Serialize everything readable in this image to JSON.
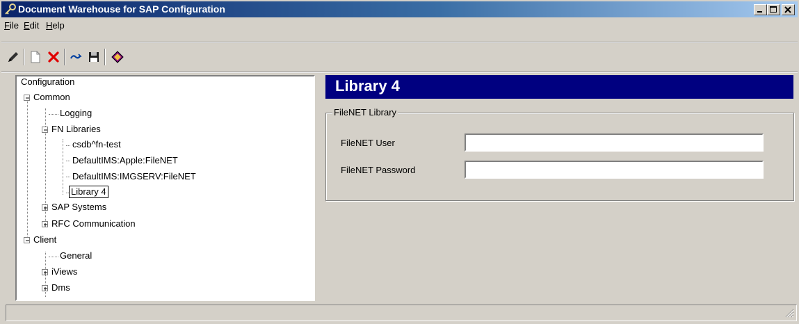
{
  "window": {
    "title": "Document Warehouse for SAP Configuration"
  },
  "menu": [
    {
      "pre": "",
      "ul": "F",
      "post": "ile"
    },
    {
      "pre": "",
      "ul": "E",
      "post": "dit"
    },
    {
      "pre": "",
      "ul": "H",
      "post": "elp"
    }
  ],
  "toolbar": {
    "icons": [
      "pencil-icon",
      "new-document-icon",
      "delete-icon",
      "refresh-icon",
      "save-icon",
      "help-book-icon"
    ]
  },
  "tree": {
    "root": "Configuration",
    "common": "Common",
    "logging": "Logging",
    "fn_libraries": "FN Libraries",
    "lib1": "csdb^fn-test",
    "lib2": "DefaultIMS:Apple:FileNET",
    "lib3": "DefaultIMS:IMGSERV:FileNET",
    "lib4": "Library 4",
    "sap_systems": "SAP Systems",
    "rfc": "RFC Communication",
    "client": "Client",
    "general": "General",
    "iviews": "iViews",
    "dms": "Dms",
    "selected": "Library 4"
  },
  "panel": {
    "title": "Library 4",
    "group_title": "FileNET Library",
    "user_label": "FileNET User",
    "user_value": "",
    "password_label": "FileNET Password",
    "password_value": ""
  },
  "colors": {
    "header_bg": "#000080",
    "title_start": "#0a246a",
    "title_end": "#a6caf0",
    "face": "#d4d0c8"
  }
}
